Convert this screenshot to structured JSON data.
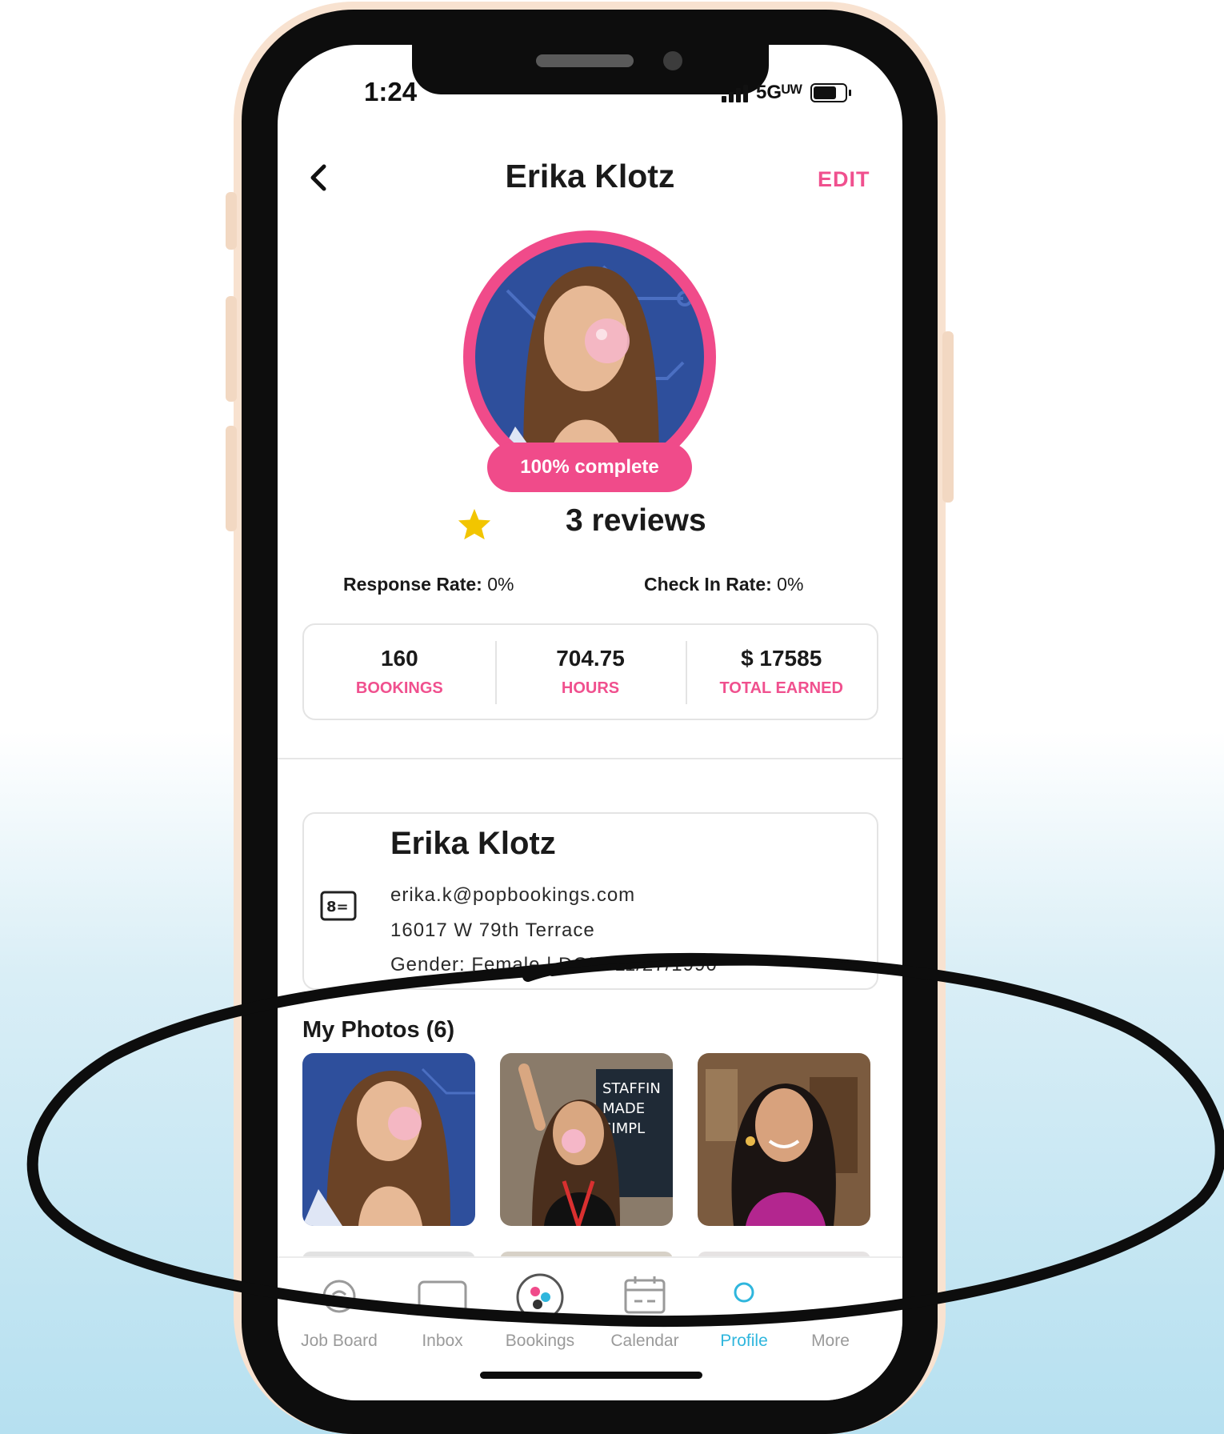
{
  "status_bar": {
    "time": "1:24",
    "network": "5Gᵁᵂ"
  },
  "header": {
    "title": "Erika Klotz",
    "edit_label": "EDIT"
  },
  "profile": {
    "completion": "100% complete",
    "reviews": "3 reviews",
    "response_rate_label": "Response Rate:",
    "response_rate_value": "0%",
    "checkin_rate_label": "Check In Rate:",
    "checkin_rate_value": "0%"
  },
  "stats": [
    {
      "value": "160",
      "label": "BOOKINGS"
    },
    {
      "value": "704.75",
      "label": "HOURS"
    },
    {
      "value": "$ 17585",
      "label": "TOTAL EARNED"
    }
  ],
  "info": {
    "name": "Erika Klotz",
    "email": "erika.k@popbookings.com",
    "address": "16017 W 79th Terrace",
    "details": "Gender: Female | DOB: 11/27/1990"
  },
  "photos": {
    "title": "My Photos (6)"
  },
  "tabs": [
    {
      "label": "Job Board",
      "icon": "job-board-icon"
    },
    {
      "label": "Inbox",
      "icon": "inbox-icon"
    },
    {
      "label": "Bookings",
      "icon": "bookings-icon"
    },
    {
      "label": "Calendar",
      "icon": "calendar-icon"
    },
    {
      "label": "Profile",
      "icon": "profile-icon"
    },
    {
      "label": "More",
      "icon": "more-icon"
    }
  ],
  "colors": {
    "accent": "#f04b8a",
    "active_tab": "#2fb6dd",
    "star": "#f2c500",
    "phone_frame": "#f8e2d0"
  }
}
